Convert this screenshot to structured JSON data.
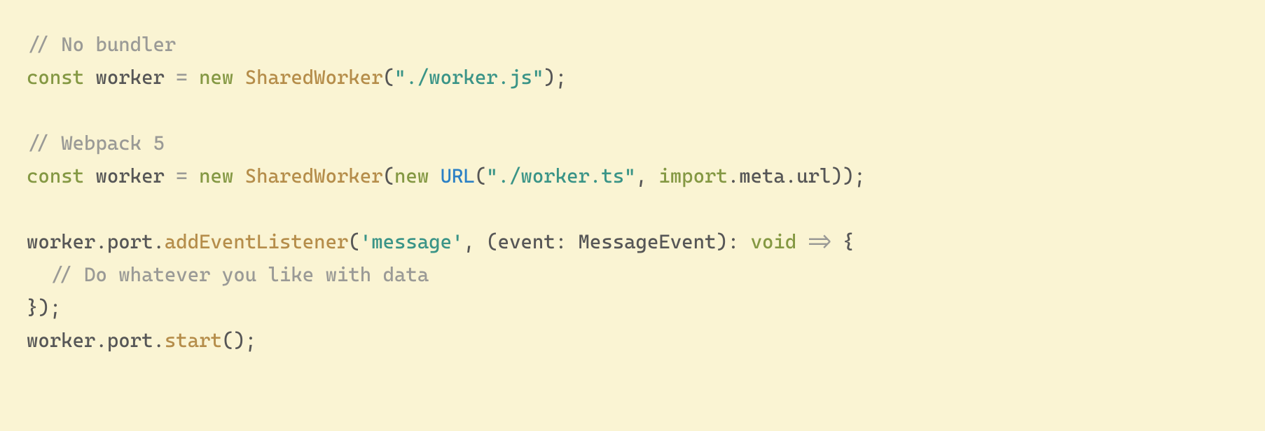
{
  "code": {
    "line1": {
      "comment": "// No bundler"
    },
    "line2": {
      "kw_const": "const",
      "ident": " worker ",
      "eq": "=",
      "sp1": " ",
      "kw_new": "new",
      "sp2": " ",
      "cls": "SharedWorker",
      "lpar": "(",
      "str": "\"./worker.js\"",
      "rpar_semi": ");"
    },
    "line3": "",
    "line4": {
      "comment": "// Webpack 5"
    },
    "line5": {
      "kw_const": "const",
      "ident": " worker ",
      "eq": "=",
      "sp1": " ",
      "kw_new": "new",
      "sp2": " ",
      "cls": "SharedWorker",
      "lpar": "(",
      "kw_new2": "new",
      "sp3": " ",
      "cls2": "URL",
      "lpar2": "(",
      "str": "\"./worker.ts\"",
      "comma": ", ",
      "kw_import": "import",
      "tail": ".meta.url));"
    },
    "line6": "",
    "line7": {
      "head": "worker.port.",
      "method": "addEventListener",
      "lpar": "(",
      "str": "'message'",
      "mid": ", (event: MessageEvent): ",
      "type": "void",
      "sp": " ",
      "arrow": "=>",
      "tail": " {"
    },
    "line8": {
      "indent": "  ",
      "comment": "// Do whatever you like with data"
    },
    "line9": {
      "text": "});"
    },
    "line10": {
      "head": "worker.port.",
      "method": "start",
      "tail": "();"
    }
  }
}
